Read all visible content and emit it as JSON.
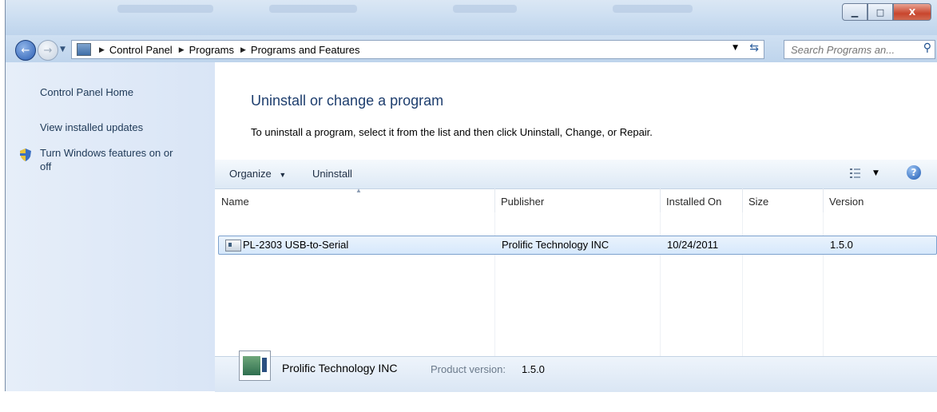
{
  "window": {
    "minimize_glyph": "▁",
    "maximize_glyph": "□",
    "close_glyph": "X"
  },
  "nav": {
    "back_glyph": "←",
    "forward_glyph": "→",
    "breadcrumbs": [
      "Control Panel",
      "Programs",
      "Programs and Features"
    ],
    "search_placeholder": "Search Programs an..."
  },
  "sidebar": {
    "items": [
      {
        "label": "Control Panel Home"
      },
      {
        "label": "View installed updates"
      },
      {
        "label": "Turn Windows features on or"
      },
      {
        "label": "off"
      }
    ]
  },
  "main": {
    "title": "Uninstall or change a program",
    "description": "To uninstall a program, select it from the list and then click Uninstall, Change, or Repair."
  },
  "toolbar": {
    "organize_label": "Organize",
    "uninstall_label": "Uninstall",
    "help_glyph": "?"
  },
  "table": {
    "columns": [
      "Name",
      "Publisher",
      "Installed On",
      "Size",
      "Version"
    ],
    "rows": [
      {
        "name": "PL-2303 USB-to-Serial",
        "publisher": "Prolific Technology INC",
        "installed_on": "10/24/2011",
        "size": "",
        "version": "1.5.0"
      }
    ]
  },
  "details": {
    "publisher": "Prolific Technology INC",
    "version_label": "Product version:",
    "version_value": "1.5.0"
  },
  "colors": {
    "accent_title": "#1e3e6e",
    "selected_row": "#d6e8fb"
  }
}
